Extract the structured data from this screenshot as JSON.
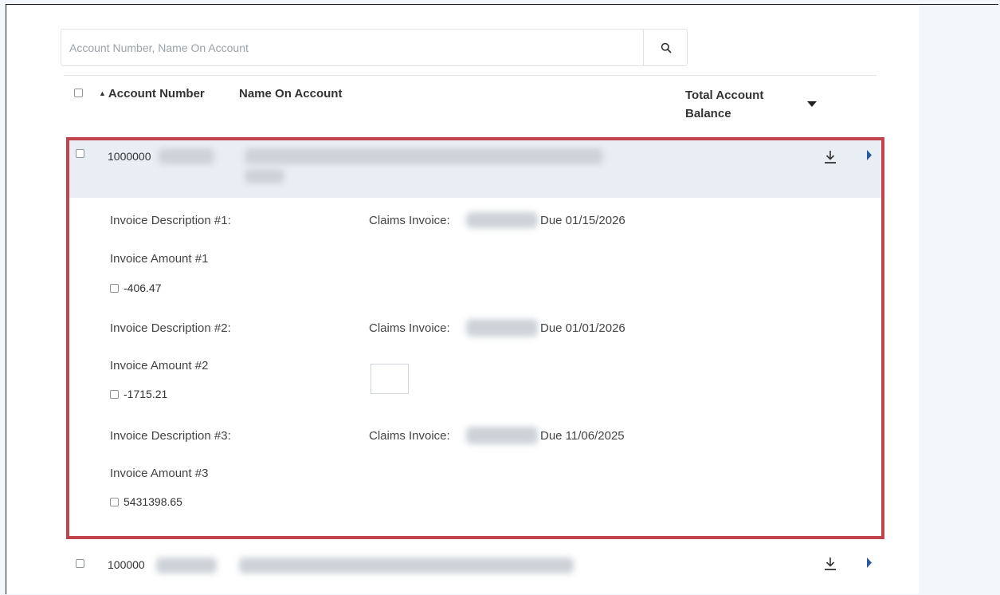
{
  "search": {
    "placeholder": "Account Number, Name On Account"
  },
  "table": {
    "headers": {
      "sort_indicator": "▲",
      "account_number": "Account Number",
      "name_on_account": "Name On Account",
      "total_balance": "Total Account Balance"
    },
    "rows": [
      {
        "account_number": "1000000",
        "expanded": true,
        "invoices": [
          {
            "description_label": "Invoice Description #1:",
            "claims_label": "Claims Invoice:",
            "due": "Due 01/15/2026",
            "amount_label": "Invoice Amount #1",
            "amount": "-406.47"
          },
          {
            "description_label": "Invoice Description #2:",
            "claims_label": "Claims Invoice:",
            "due": "Due 01/01/2026",
            "amount_label": "Invoice Amount #2",
            "amount": "-1715.21"
          },
          {
            "description_label": "Invoice Description #3:",
            "claims_label": "Claims Invoice:",
            "due": "Due 11/06/2025",
            "amount_label": "Invoice Amount #3",
            "amount": "5431398.65"
          }
        ]
      },
      {
        "account_number": "100000",
        "expanded": false
      }
    ]
  },
  "colors": {
    "highlight_border": "#c0454b",
    "row_bg": "#e9eef5",
    "arrow": "#2a5a9e"
  },
  "icons": [
    "search-icon",
    "download-icon",
    "expand-arrow-icon",
    "sort-caret-icon"
  ]
}
